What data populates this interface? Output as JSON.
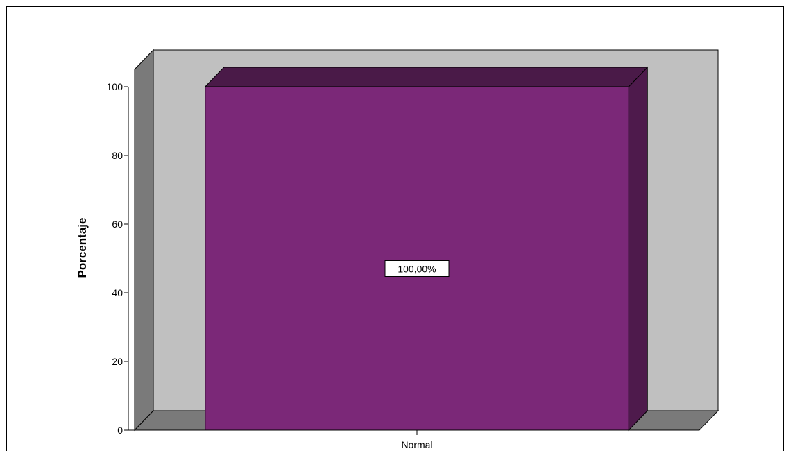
{
  "chart_data": {
    "type": "bar",
    "categories": [
      "Normal"
    ],
    "values": [
      100
    ],
    "data_labels": [
      "100,00%"
    ],
    "title": "",
    "xlabel": "",
    "ylabel": "Porcentaje",
    "ylim": [
      0,
      100
    ],
    "yticks": [
      0,
      20,
      40,
      60,
      80,
      100
    ],
    "three_d": true,
    "grid": false,
    "legend": "none"
  },
  "colors": {
    "bar_front": "#7b2878",
    "bar_side": "#4e1a4c",
    "bar_top": "#4a1a48",
    "back_wall": "#c0c0c0",
    "side_wall": "#7a7a7a",
    "floor": "#7a7a7a"
  }
}
